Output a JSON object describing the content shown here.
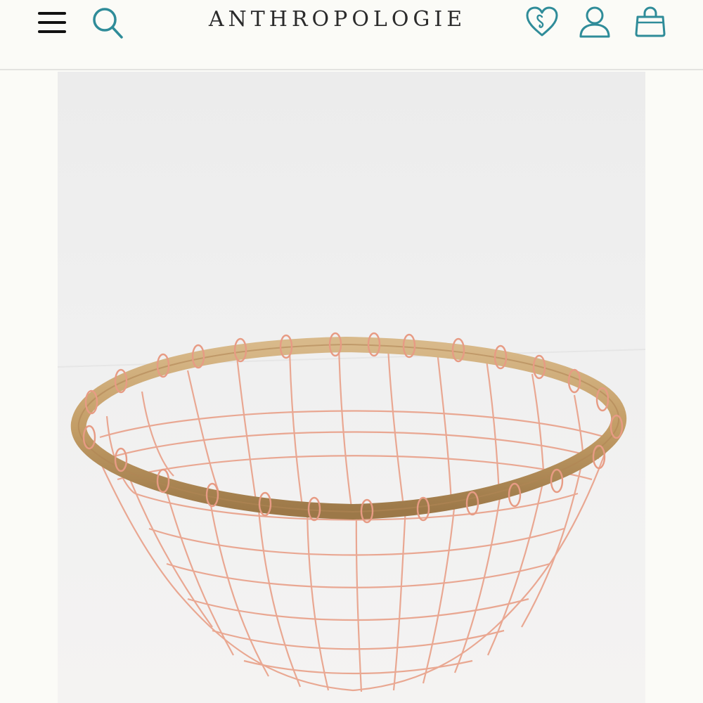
{
  "header": {
    "brand": "ANTHROPOLOGIE",
    "icons": {
      "menu": "hamburger-menu-icon",
      "search": "search-icon",
      "wishlist": "heart-icon",
      "account": "user-icon",
      "bag": "shopping-bag-icon"
    }
  },
  "colors": {
    "accent": "#2f8c99",
    "background": "#fbfbf7",
    "brand_text": "#2b2b2b",
    "photo_background": "#efefef",
    "wire": "#e8a58f",
    "rim": "#c9a472"
  },
  "product": {
    "image": "copper-wire-basket-photo"
  }
}
